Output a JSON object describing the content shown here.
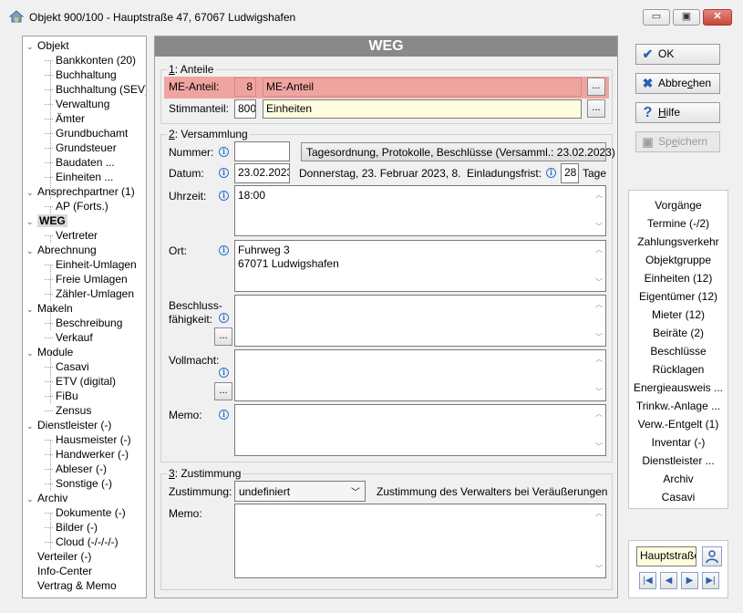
{
  "window": {
    "title": "Objekt 900/100 - Hauptstraße 47, 67067 Ludwigshafen",
    "min": "▭",
    "max": "▣",
    "close": "✕"
  },
  "tree": [
    {
      "label": "Objekt",
      "level": 0,
      "exp": "chev-down"
    },
    {
      "label": "Bankkonten (20)",
      "level": 1
    },
    {
      "label": "Buchhaltung",
      "level": 1
    },
    {
      "label": "Buchhaltung (SEV)",
      "level": 1
    },
    {
      "label": "Verwaltung",
      "level": 1
    },
    {
      "label": "Ämter",
      "level": 1
    },
    {
      "label": "Grundbuchamt",
      "level": 1
    },
    {
      "label": "Grundsteuer",
      "level": 1
    },
    {
      "label": "Baudaten ...",
      "level": 1
    },
    {
      "label": "Einheiten ...",
      "level": 1
    },
    {
      "label": "Ansprechpartner (1)",
      "level": 0,
      "exp": "chev-down"
    },
    {
      "label": "AP (Forts.)",
      "level": 1
    },
    {
      "label": "WEG",
      "level": 0,
      "exp": "chev-down",
      "selected": true
    },
    {
      "label": "Vertreter",
      "level": 1
    },
    {
      "label": "Abrechnung",
      "level": 0,
      "exp": "chev-down"
    },
    {
      "label": "Einheit-Umlagen",
      "level": 1
    },
    {
      "label": "Freie Umlagen",
      "level": 1
    },
    {
      "label": "Zähler-Umlagen",
      "level": 1
    },
    {
      "label": "Makeln",
      "level": 0,
      "exp": "chev-down"
    },
    {
      "label": "Beschreibung",
      "level": 1
    },
    {
      "label": "Verkauf",
      "level": 1
    },
    {
      "label": "Module",
      "level": 0,
      "exp": "chev-down"
    },
    {
      "label": "Casavi",
      "level": 1
    },
    {
      "label": "ETV (digital)",
      "level": 1
    },
    {
      "label": "FiBu",
      "level": 1
    },
    {
      "label": "Zensus",
      "level": 1
    },
    {
      "label": "Dienstleister (-)",
      "level": 0,
      "exp": "chev-down"
    },
    {
      "label": "Hausmeister (-)",
      "level": 1
    },
    {
      "label": "Handwerker (-)",
      "level": 1
    },
    {
      "label": "Ableser (-)",
      "level": 1
    },
    {
      "label": "Sonstige (-)",
      "level": 1
    },
    {
      "label": "Archiv",
      "level": 0,
      "exp": "chev-down"
    },
    {
      "label": "Dokumente (-)",
      "level": 1
    },
    {
      "label": "Bilder (-)",
      "level": 1
    },
    {
      "label": "Cloud (-/-/-/-)",
      "level": 1
    },
    {
      "label": "Verteiler (-)",
      "level": 0
    },
    {
      "label": "Info-Center",
      "level": 0
    },
    {
      "label": "Vertrag & Memo",
      "level": 0
    }
  ],
  "header": "WEG",
  "anteile": {
    "title_num": "1",
    "title_rest": ": Anteile",
    "me_label": "ME-Anteil:",
    "me_value": "8",
    "me_text": "ME-Anteil",
    "stimm_label": "Stimmanteil:",
    "stimm_value": "800",
    "stimm_text": "Einheiten",
    "ellipsis": "..."
  },
  "versammlung": {
    "title_num": "2",
    "title_rest": ": Versammlung",
    "nummer_label": "Nummer:",
    "nummer_value": "",
    "tagesordnung_button": "Tagesordnung, Protokolle, Beschlüsse (Versamml.: 23.02.2023)",
    "datum_label": "Datum:",
    "datum_value": "23.02.2023",
    "datum_text": "Donnerstag,  23. Februar 2023,  8.",
    "einladung_label": "Einladungsfrist:",
    "einladung_value": "28",
    "tage": "Tage",
    "uhrzeit_label": "Uhrzeit:",
    "uhrzeit_value": "18:00",
    "ort_label": "Ort:",
    "ort_value": "Fuhrweg 3\n67071 Ludwigshafen",
    "beschluss_label1": "Beschluss-",
    "beschluss_label2": "fähigkeit:",
    "beschluss_value": "",
    "vollmacht_label": "Vollmacht:",
    "vollmacht_value": "",
    "memo_label": "Memo:",
    "memo_value": "",
    "ellipsis": "..."
  },
  "zustimmung": {
    "title_num": "3",
    "title_rest": ": Zustimmung",
    "label": "Zustimmung:",
    "value": "undefiniert",
    "description": "Zustimmung des Verwalters bei Veräußerungen",
    "memo_label": "Memo:",
    "memo_value": ""
  },
  "buttons": {
    "ok": "OK",
    "abbrechen_pre": "Abbre",
    "abbrechen_u": "c",
    "abbrechen_post": "hen",
    "hilfe_u": "H",
    "hilfe_post": "ilfe",
    "speichern_pre": "Sp",
    "speichern_u": "e",
    "speichern_post": "ichern"
  },
  "links": [
    "Vorgänge",
    "Termine (-/2)",
    "Zahlungsverkehr",
    "Objektgruppe",
    "Einheiten (12)",
    "Eigentümer (12)",
    "Mieter (12)",
    "Beiräte (2)",
    "Beschlüsse",
    "Rücklagen",
    "Energieausweis ...",
    "Trinkw.-Anlage ...",
    "Verw.-Entgelt (1)",
    "Inventar (-)",
    "Dienstleister ...",
    "Archiv",
    "Casavi"
  ],
  "nav": {
    "search_value": "Hauptstraße",
    "first": "|◀",
    "prev": "◀",
    "next": "▶",
    "last": "▶|"
  },
  "colors": {
    "header_bg": "#898989",
    "me_highlight": "#f0a4a0",
    "yellow_field": "#fffde0",
    "info_blue": "#2a6fcf"
  }
}
